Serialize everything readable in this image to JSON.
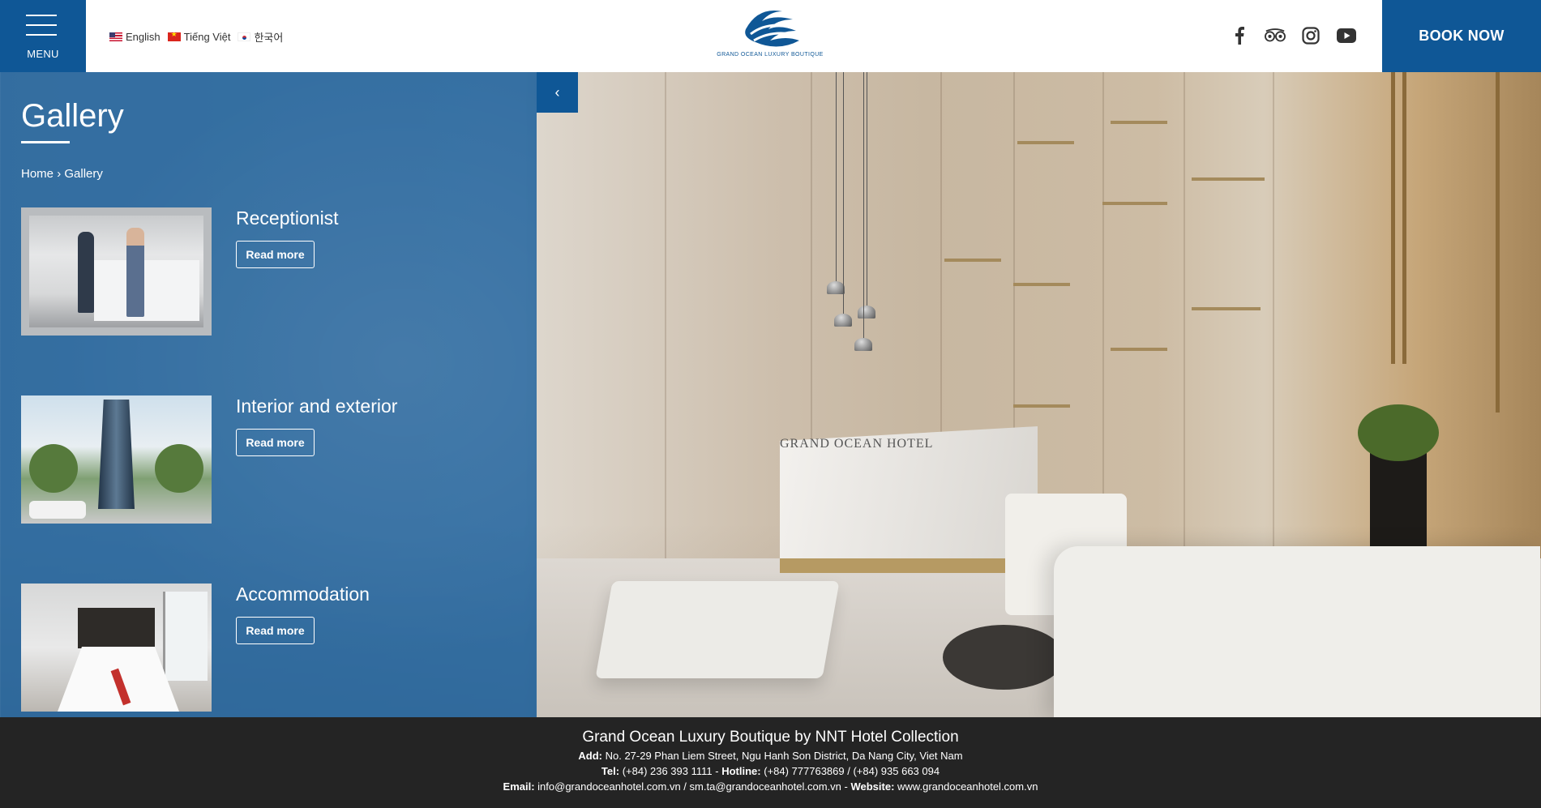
{
  "header": {
    "menu_label": "MENU",
    "languages": [
      {
        "label": "English",
        "flag": "us"
      },
      {
        "label": "Tiếng Việt",
        "flag": "vn"
      },
      {
        "label": "한국어",
        "flag": "kr"
      }
    ],
    "logo_text": "GRAND OCEAN LUXURY BOUTIQUE",
    "socials": [
      "facebook-icon",
      "tripadvisor-icon",
      "instagram-icon",
      "youtube-icon"
    ],
    "book_now": "BOOK NOW"
  },
  "panel": {
    "title": "Gallery",
    "breadcrumb": {
      "home": "Home",
      "sep": "›",
      "current": "Gallery"
    },
    "items": [
      {
        "title": "Receptionist",
        "button": "Read more"
      },
      {
        "title": "Interior and exterior",
        "button": "Read more"
      },
      {
        "title": "Accommodation",
        "button": "Read more"
      }
    ],
    "back_arrow": "‹"
  },
  "hero": {
    "desk_sign": "GRAND OCEAN HOTEL"
  },
  "footer": {
    "title": "Grand Ocean Luxury Boutique by NNT Hotel Collection",
    "add_label": "Add:",
    "address": "No. 27-29 Phan Liem Street, Ngu Hanh Son District, Da Nang City, Viet Nam",
    "tel_label": "Tel:",
    "tel": "(+84) 236 393 1111",
    "hotline_label": "Hotline:",
    "hotline": "(+84) 777763869 / (+84) 935 663 094",
    "email_label": "Email:",
    "email": "info@grandoceanhotel.com.vn / sm.ta@grandoceanhotel.com.vn",
    "website_label": "Website:",
    "website": "www.grandoceanhotel.com.vn"
  },
  "colors": {
    "brand_blue": "#0f5796",
    "footer_bg": "#242424"
  }
}
